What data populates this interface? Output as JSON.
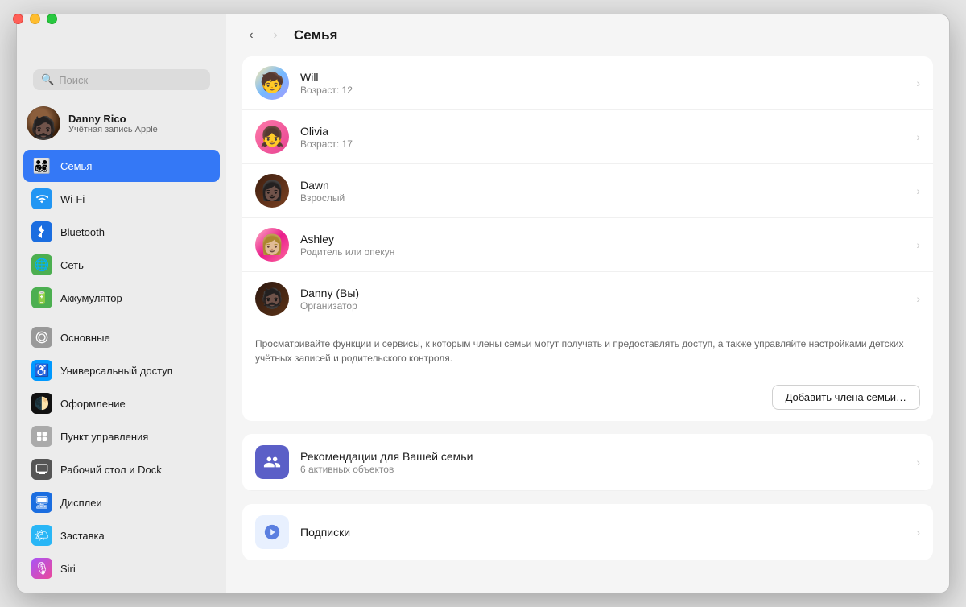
{
  "window": {
    "title": "Семья"
  },
  "traffic_lights": {
    "close": "×",
    "minimize": "−",
    "maximize": "+"
  },
  "sidebar": {
    "search_placeholder": "Поиск",
    "user": {
      "name": "Danny Rico",
      "subtitle": "Учётная запись Apple"
    },
    "nav_items": [
      {
        "id": "family",
        "label": "Семья",
        "icon": "👨‍👩‍👧‍👦",
        "active": true
      },
      {
        "id": "wifi",
        "label": "Wi-Fi",
        "icon": "📶"
      },
      {
        "id": "bluetooth",
        "label": "Bluetooth",
        "icon": "✳"
      },
      {
        "id": "network",
        "label": "Сеть",
        "icon": "🌐"
      },
      {
        "id": "battery",
        "label": "Аккумулятор",
        "icon": "🔋"
      },
      {
        "id": "general",
        "label": "Основные",
        "icon": "⚙️"
      },
      {
        "id": "accessibility",
        "label": "Универсальный доступ",
        "icon": "♿"
      },
      {
        "id": "appearance",
        "label": "Оформление",
        "icon": "🌓"
      },
      {
        "id": "control",
        "label": "Пункт управления",
        "icon": "▦"
      },
      {
        "id": "desktop",
        "label": "Рабочий стол и Dock",
        "icon": "▣"
      },
      {
        "id": "displays",
        "label": "Дисплеи",
        "icon": "🖥"
      },
      {
        "id": "screensaver",
        "label": "Заставка",
        "icon": "🌤"
      },
      {
        "id": "siri",
        "label": "Siri",
        "icon": "🎙"
      }
    ]
  },
  "main": {
    "title": "Семья",
    "nav_back": "<",
    "nav_forward": ">",
    "members": [
      {
        "name": "Will",
        "role": "Возраст: 12",
        "avatar_emoji": "🧒",
        "avatar_class": "av-will"
      },
      {
        "name": "Olivia",
        "role": "Возраст: 17",
        "avatar_emoji": "👧",
        "avatar_class": "av-olivia"
      },
      {
        "name": "Dawn",
        "role": "Взрослый",
        "avatar_emoji": "👩",
        "avatar_class": "av-dawn"
      },
      {
        "name": "Ashley",
        "role": "Родитель или опекун",
        "avatar_emoji": "👩",
        "avatar_class": "av-ashley"
      },
      {
        "name": "Danny (Вы)",
        "role": "Организатор",
        "avatar_emoji": "🧔",
        "avatar_class": "av-danny"
      }
    ],
    "description": "Просматривайте функции и сервисы, к которым члены семьи могут получать и предоставлять доступ, а также управляйте настройками детских учётных записей и родительского контроля.",
    "add_button": "Добавить члена семьи…",
    "recommendations": {
      "title": "Рекомендации для Вашей семьи",
      "subtitle": "6 активных объектов"
    },
    "subscriptions": {
      "title": "Подписки"
    }
  }
}
